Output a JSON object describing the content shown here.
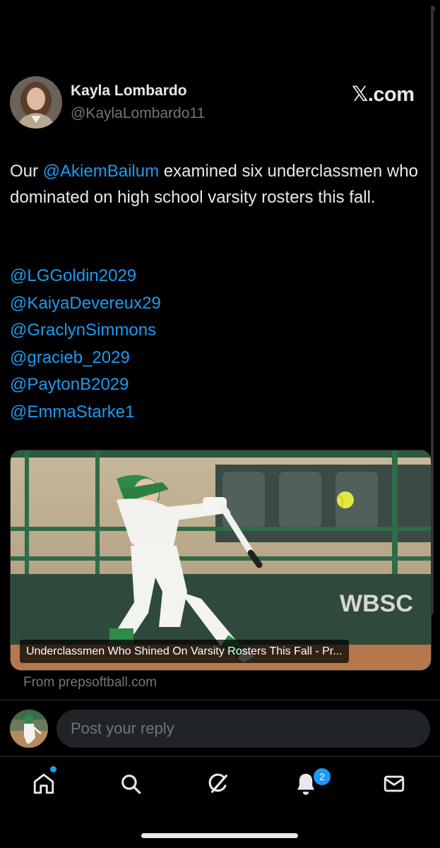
{
  "author": {
    "name": "Kayla Lombardo",
    "handle": "@KaylaLombardo11"
  },
  "source_logo": "𝕏.com",
  "tweet": {
    "prefix": "Our ",
    "mention": "@AkiemBailum",
    "suffix": " examined six underclassmen who dominated on high school varsity rosters this fall.",
    "mentions": [
      "@LGGoldin2029",
      "@KaiyaDevereux29",
      "@GraclynSimmons",
      "@gracieb_2029",
      "@PaytonB2029",
      "@EmmaStarke1"
    ]
  },
  "card": {
    "title": "Underclassmen Who Shined On Varsity Rosters This Fall - Pr...",
    "source": "From prepsoftball.com",
    "sign_text": "WBSC"
  },
  "reply": {
    "placeholder": "Post your reply"
  },
  "tabbar": {
    "tabs": [
      "home-icon",
      "search-icon",
      "grok-icon",
      "notifications-icon",
      "messages-icon"
    ],
    "notifications_badge": "2"
  },
  "colors": {
    "accent": "#1d9bf0",
    "background": "#000000",
    "text": "#e7e9ea",
    "secondary": "#71767b"
  }
}
